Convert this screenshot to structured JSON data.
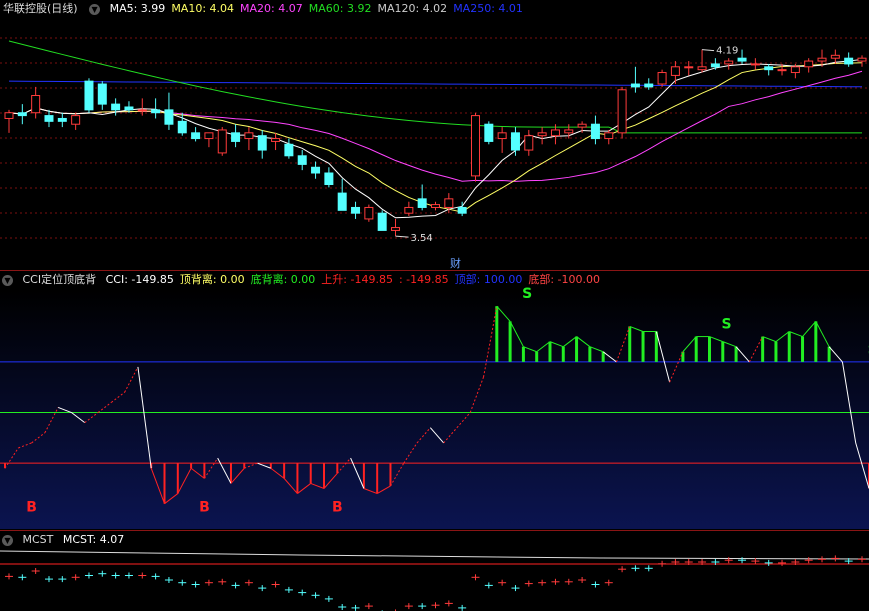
{
  "colors": {
    "up": "#ff3b3b",
    "down": "#54ffff",
    "ma5": "#ffffff",
    "ma10": "#ffff66",
    "ma20": "#ff44ff",
    "ma60": "#22dd22",
    "ma120": "#cccccc",
    "ma250": "#2233ff",
    "cci": "#ffffff",
    "green": "#22ee22",
    "red": "#ff2222",
    "blue": "#2233ff",
    "grid": "#7a1010"
  },
  "price_panel": {
    "title": "华联控股(日线)",
    "legend": [
      {
        "text": "MA5: 3.99",
        "color": "#ffffff"
      },
      {
        "text": "MA10: 4.04",
        "color": "#ffff66"
      },
      {
        "text": "MA20: 4.07",
        "color": "#ff44ff"
      },
      {
        "text": "MA60: 3.92",
        "color": "#22dd22"
      },
      {
        "text": "MA120: 4.02",
        "color": "#cccccc"
      },
      {
        "text": "MA250: 4.01",
        "color": "#2233ff"
      }
    ],
    "high_label": "4.19",
    "low_label": "3.54",
    "cai_label": "财"
  },
  "cci_panel": {
    "title": "CCI定位顶底背",
    "legend": [
      {
        "text": "CCI: -149.85",
        "color": "#ffffff"
      },
      {
        "text": "顶背离: 0.00",
        "color": "#ffff66"
      },
      {
        "text": "底背离: 0.00",
        "color": "#22ee22"
      },
      {
        "text": "上升: -149.85",
        "color": "#ff2222"
      },
      {
        "text": ": -149.85",
        "color": "#ff2222"
      },
      {
        "text": "顶部: 100.00",
        "color": "#2233ff"
      },
      {
        "text": "底部: -100.00",
        "color": "#ff4444"
      }
    ],
    "buy_label": "B",
    "sell_label": "S"
  },
  "mcst_panel": {
    "title": "MCST",
    "legend": [
      {
        "text": "MCST: 4.07",
        "color": "#ffffff"
      }
    ]
  },
  "chart_data": [
    {
      "type": "candlestick",
      "title": "华联控股(日线)",
      "ylim": [
        3.45,
        4.3
      ],
      "candles": [
        [
          3.95,
          3.98,
          3.9,
          3.97
        ],
        [
          3.97,
          4.0,
          3.93,
          3.96
        ],
        [
          3.97,
          4.06,
          3.95,
          4.03
        ],
        [
          3.96,
          3.98,
          3.92,
          3.94
        ],
        [
          3.95,
          3.97,
          3.92,
          3.94
        ],
        [
          3.93,
          3.97,
          3.91,
          3.96
        ],
        [
          4.08,
          4.09,
          3.97,
          3.98
        ],
        [
          4.07,
          4.08,
          3.98,
          4.0
        ],
        [
          4.0,
          4.02,
          3.96,
          3.98
        ],
        [
          3.99,
          4.01,
          3.97,
          3.98
        ],
        [
          3.98,
          4.02,
          3.96,
          3.98
        ],
        [
          3.98,
          4.02,
          3.95,
          3.97
        ],
        [
          3.98,
          4.04,
          3.91,
          3.93
        ],
        [
          3.94,
          3.97,
          3.89,
          3.9
        ],
        [
          3.9,
          3.92,
          3.87,
          3.88
        ],
        [
          3.88,
          3.9,
          3.85,
          3.9
        ],
        [
          3.83,
          3.92,
          3.82,
          3.91
        ],
        [
          3.9,
          3.93,
          3.85,
          3.87
        ],
        [
          3.88,
          3.92,
          3.84,
          3.9
        ],
        [
          3.89,
          3.91,
          3.81,
          3.84
        ],
        [
          3.87,
          3.9,
          3.84,
          3.88
        ],
        [
          3.86,
          3.88,
          3.81,
          3.82
        ],
        [
          3.82,
          3.84,
          3.77,
          3.79
        ],
        [
          3.78,
          3.8,
          3.74,
          3.76
        ],
        [
          3.76,
          3.78,
          3.71,
          3.72
        ],
        [
          3.69,
          3.74,
          3.64,
          3.63
        ],
        [
          3.64,
          3.66,
          3.6,
          3.62
        ],
        [
          3.6,
          3.65,
          3.59,
          3.64
        ],
        [
          3.62,
          3.63,
          3.56,
          3.56
        ],
        [
          3.56,
          3.6,
          3.54,
          3.57
        ],
        [
          3.62,
          3.66,
          3.61,
          3.64
        ],
        [
          3.67,
          3.72,
          3.63,
          3.64
        ],
        [
          3.64,
          3.66,
          3.63,
          3.65
        ],
        [
          3.64,
          3.69,
          3.62,
          3.67
        ],
        [
          3.64,
          3.66,
          3.61,
          3.62
        ],
        [
          3.75,
          3.97,
          3.73,
          3.96
        ],
        [
          3.93,
          3.94,
          3.86,
          3.87
        ],
        [
          3.88,
          3.92,
          3.83,
          3.9
        ],
        [
          3.9,
          3.92,
          3.82,
          3.84
        ],
        [
          3.84,
          3.91,
          3.82,
          3.89
        ],
        [
          3.89,
          3.92,
          3.86,
          3.9
        ],
        [
          3.89,
          3.93,
          3.86,
          3.91
        ],
        [
          3.9,
          3.93,
          3.88,
          3.91
        ],
        [
          3.92,
          3.94,
          3.9,
          3.93
        ],
        [
          3.93,
          3.96,
          3.86,
          3.88
        ],
        [
          3.88,
          3.91,
          3.86,
          3.9
        ],
        [
          3.9,
          4.06,
          3.88,
          4.05
        ],
        [
          4.07,
          4.13,
          4.04,
          4.06
        ],
        [
          4.07,
          4.09,
          4.05,
          4.06
        ],
        [
          4.07,
          4.12,
          4.06,
          4.11
        ],
        [
          4.1,
          4.15,
          4.07,
          4.13
        ],
        [
          4.13,
          4.15,
          4.1,
          4.13
        ],
        [
          4.12,
          4.19,
          4.11,
          4.13
        ],
        [
          4.14,
          4.16,
          4.12,
          4.13
        ],
        [
          4.14,
          4.16,
          4.12,
          4.15
        ],
        [
          4.16,
          4.19,
          4.14,
          4.15
        ],
        [
          4.14,
          4.16,
          4.12,
          4.14
        ],
        [
          4.13,
          4.14,
          4.1,
          4.12
        ],
        [
          4.12,
          4.14,
          4.1,
          4.12
        ],
        [
          4.11,
          4.14,
          4.09,
          4.13
        ],
        [
          4.13,
          4.16,
          4.11,
          4.15
        ],
        [
          4.15,
          4.19,
          4.13,
          4.16
        ],
        [
          4.16,
          4.19,
          4.14,
          4.17
        ],
        [
          4.16,
          4.18,
          4.13,
          4.14
        ],
        [
          4.15,
          4.17,
          4.13,
          4.16
        ]
      ]
    },
    {
      "type": "line",
      "title": "CCI定位顶底背",
      "ylim": [
        -230,
        240
      ],
      "series": [
        {
          "name": "CCI",
          "values": [
            -110,
            -70,
            -60,
            -40,
            10,
            0,
            -20,
            0,
            20,
            40,
            90,
            -110,
            -180,
            -160,
            -110,
            -130,
            -90,
            -140,
            -110,
            -100,
            -110,
            -130,
            -160,
            -140,
            -150,
            -120,
            -90,
            -150,
            -160,
            -145,
            -100,
            -60,
            -30,
            -60,
            -30,
            0,
            70,
            210,
            180,
            130,
            120,
            140,
            130,
            150,
            130,
            120,
            100,
            170,
            160,
            160,
            60,
            120,
            150,
            150,
            140,
            130,
            100,
            150,
            140,
            160,
            150,
            180,
            130,
            100,
            -60,
            -149.85
          ]
        },
        {
          "name": "顶部",
          "values": [
            100
          ]
        },
        {
          "name": "底部",
          "values": [
            -100
          ]
        }
      ]
    },
    {
      "type": "line",
      "title": "MCST",
      "series": [
        {
          "name": "MCST",
          "values": [
            4.07
          ]
        }
      ]
    }
  ]
}
